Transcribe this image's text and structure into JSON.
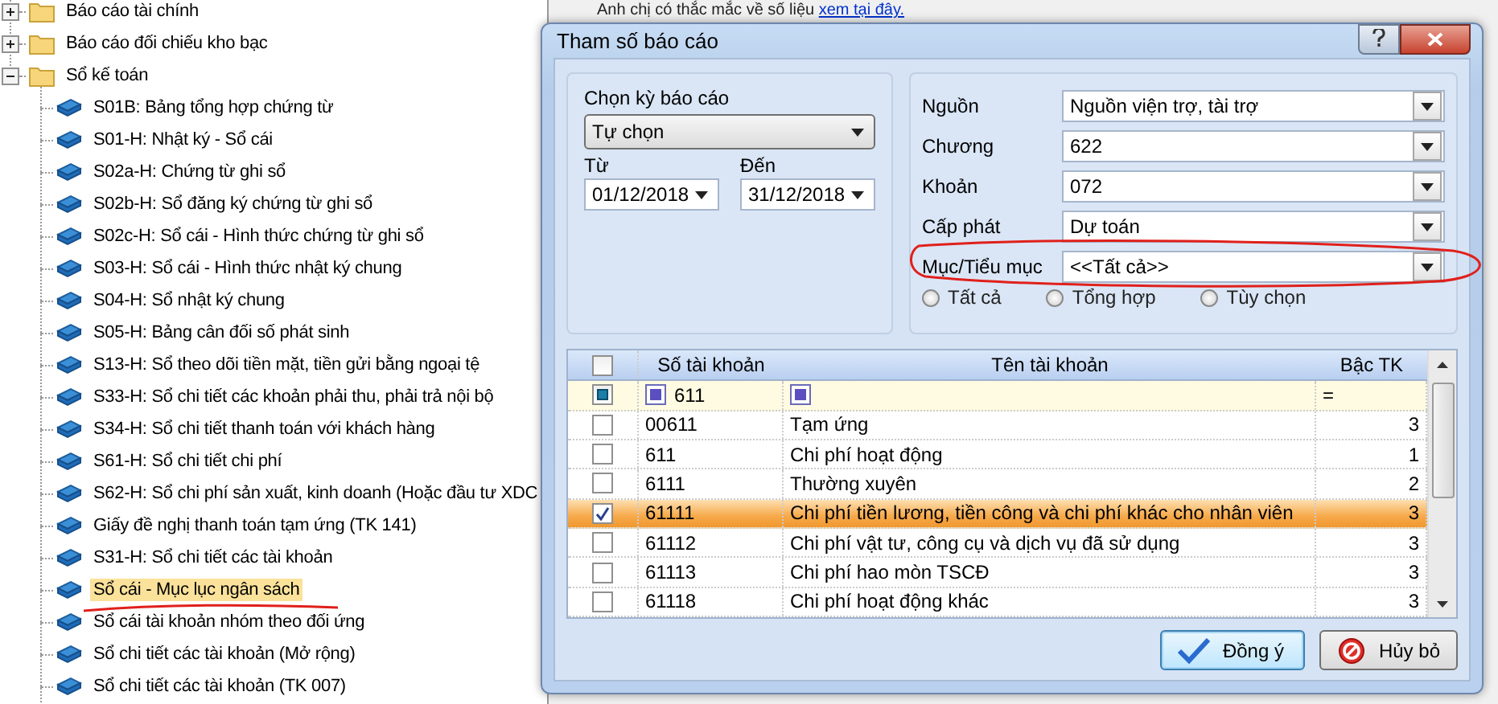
{
  "tree": [
    {
      "label": "Báo cáo tài chính",
      "expanded": false
    },
    {
      "label": "Báo cáo đối chiếu kho bạc",
      "expanded": false
    },
    {
      "label": "Sổ kế toán",
      "expanded": true,
      "children": [
        {
          "label": "S01B: Bảng tổng hợp chứng từ",
          "selected": false
        },
        {
          "label": "S01-H: Nhật ký - Sổ cái",
          "selected": false
        },
        {
          "label": "S02a-H: Chứng từ ghi sổ",
          "selected": false
        },
        {
          "label": "S02b-H: Sổ đăng ký chứng từ ghi sổ",
          "selected": false
        },
        {
          "label": "S02c-H: Sổ cái - Hình thức chứng từ ghi sổ",
          "selected": false
        },
        {
          "label": "S03-H: Sổ cái - Hình thức nhật ký chung",
          "selected": false
        },
        {
          "label": "S04-H: Sổ nhật ký chung",
          "selected": false
        },
        {
          "label": "S05-H: Bảng cân đối số phát sinh",
          "selected": false
        },
        {
          "label": "S13-H: Sổ theo dõi tiền mặt, tiền gửi bằng ngoại tệ",
          "selected": false
        },
        {
          "label": "S33-H: Sổ chi tiết các khoản phải thu, phải trả nội bộ",
          "selected": false
        },
        {
          "label": "S34-H: Sổ chi tiết thanh toán với khách hàng",
          "selected": false
        },
        {
          "label": "S61-H: Sổ chi tiết chi phí",
          "selected": false
        },
        {
          "label": "S62-H: Sổ chi phí sản xuất, kinh doanh (Hoặc đầu tư XDC",
          "selected": false
        },
        {
          "label": "Giấy đề nghị thanh toán tạm ứng (TK 141)",
          "selected": false
        },
        {
          "label": "S31-H: Sổ chi tiết các tài khoản",
          "selected": false
        },
        {
          "label": "Sổ cái - Mục lục ngân sách",
          "selected": true
        },
        {
          "label": "Sổ cái tài khoản nhóm theo đối ứng",
          "selected": false
        },
        {
          "label": "Sổ chi tiết các tài khoản (Mở rộng)",
          "selected": false
        },
        {
          "label": "Sổ chi tiết các tài khoản (TK 007)",
          "selected": false
        }
      ]
    }
  ],
  "background_notice": {
    "text": "Anh chị có thắc mắc về số liệu",
    "link": "xem tại đây."
  },
  "dialog": {
    "title": "Tham số báo cáo",
    "period": {
      "label": "Chọn kỳ báo cáo",
      "value": "Tự chọn",
      "from_label": "Từ",
      "from_value": "01/12/2018",
      "to_label": "Đến",
      "to_value": "31/12/2018"
    },
    "fields": [
      {
        "label": "Nguồn",
        "value": "Nguồn viện trợ, tài trợ"
      },
      {
        "label": "Chương",
        "value": "622"
      },
      {
        "label": "Khoản",
        "value": "072"
      },
      {
        "label": "Cấp phát",
        "value": "Dự toán"
      },
      {
        "label": "Mục/Tiểu mục",
        "value": "<<Tất cả>>"
      }
    ],
    "radios": [
      {
        "label": "Tất cả",
        "selected": false
      },
      {
        "label": "Tổng hợp",
        "selected": false
      },
      {
        "label": "Tùy chọn",
        "selected": false
      }
    ],
    "grid": {
      "columns": [
        "Số tài khoản",
        "Tên tài khoản",
        "Bậc TK"
      ],
      "header_checked": false,
      "filter": {
        "checked": true,
        "account": "611",
        "operator": "="
      },
      "rows": [
        {
          "account": "00611",
          "name": "Tạm ứng",
          "level_no": "3",
          "checked": false,
          "selected": false
        },
        {
          "account": "611",
          "name": "Chi phí hoạt động",
          "level_no": "1",
          "checked": false,
          "selected": false
        },
        {
          "account": "6111",
          "name": "Thường xuyên",
          "level_no": "2",
          "checked": false,
          "selected": false
        },
        {
          "account": "61111",
          "name": "Chi phí tiền lương, tiền công và chi phí khác cho nhân viên",
          "level_no": "3",
          "checked": true,
          "selected": true
        },
        {
          "account": "61112",
          "name": "Chi phí vật tư, công cụ và dịch vụ đã sử dụng",
          "level_no": "3",
          "checked": false,
          "selected": false
        },
        {
          "account": "61113",
          "name": "Chi phí hao mòn TSCĐ",
          "level_no": "3",
          "checked": false,
          "selected": false
        },
        {
          "account": "61118",
          "name": "Chi phí hoạt động khác",
          "level_no": "3",
          "checked": false,
          "selected": false
        }
      ]
    },
    "buttons": [
      {
        "label": "Đồng ý",
        "kind": "ok"
      },
      {
        "label": "Hủy bỏ",
        "kind": "cancel"
      }
    ]
  }
}
